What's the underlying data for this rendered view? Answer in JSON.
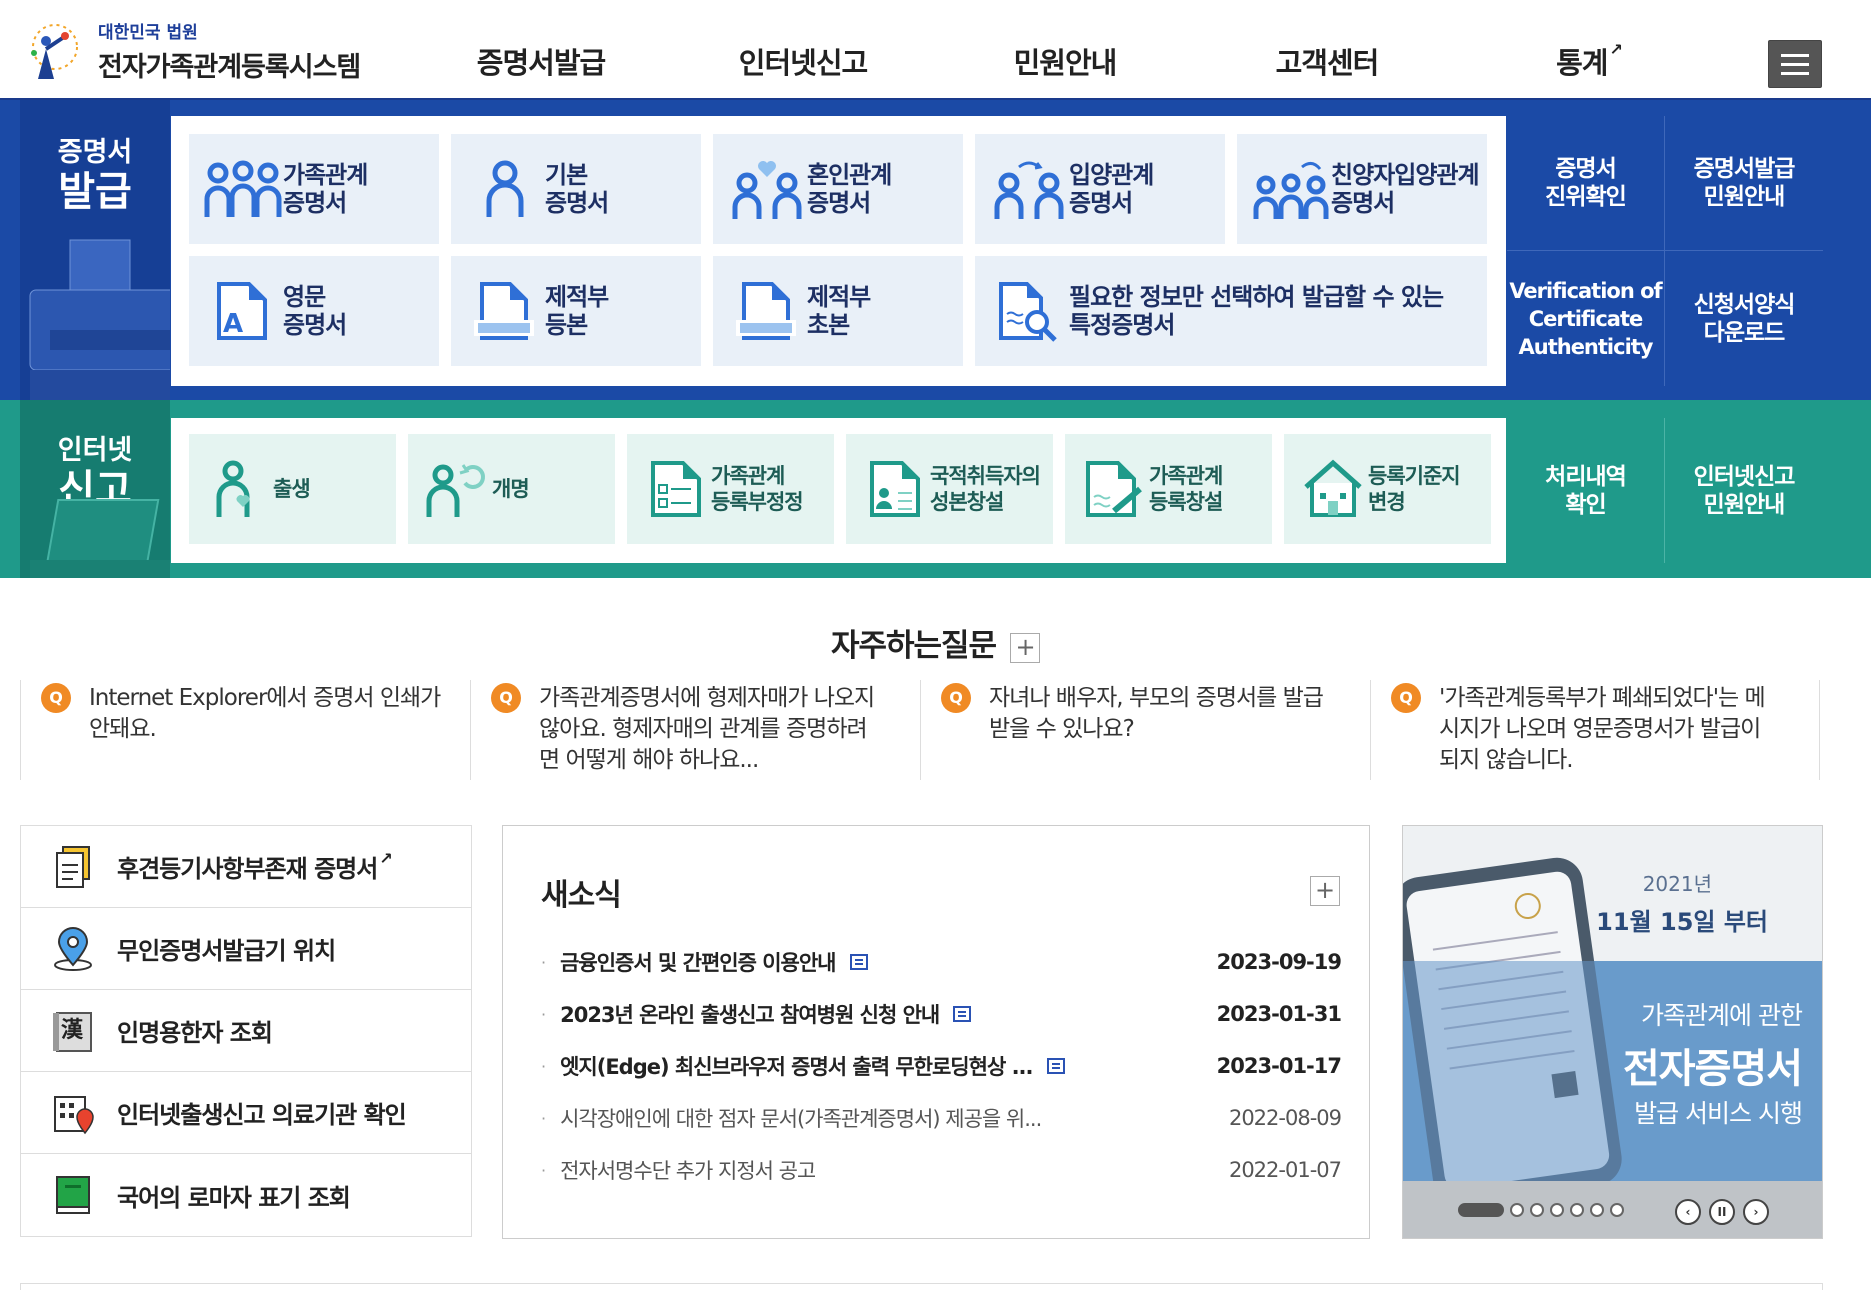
{
  "header": {
    "org": "대한민국 법원",
    "system": "전자가족관계등록시스템",
    "nav": [
      "증명서발급",
      "인터넷신고",
      "민원안내",
      "고객센터",
      "통계"
    ]
  },
  "cert": {
    "label1": "증명서",
    "label2": "발급",
    "tiles": [
      {
        "l1": "가족관계",
        "l2": "증명서",
        "icon": "family-icon"
      },
      {
        "l1": "기본",
        "l2": "증명서",
        "icon": "person-icon"
      },
      {
        "l1": "혼인관계",
        "l2": "증명서",
        "icon": "couple-heart-icon"
      },
      {
        "l1": "입양관계",
        "l2": "증명서",
        "icon": "adoption-icon"
      },
      {
        "l1": "친양자입양관계",
        "l2": "증명서",
        "icon": "full-adoption-icon"
      },
      {
        "l1": "영문",
        "l2": "증명서",
        "icon": "english-doc-icon"
      },
      {
        "l1": "제적부",
        "l2": "등본",
        "icon": "removed-register-doc-icon"
      },
      {
        "l1": "제적부",
        "l2": "초본",
        "icon": "removed-register-doc-icon"
      },
      {
        "l1": "필요한 정보만 선택하여 발급할 수 있는",
        "l2": "특정증명서",
        "icon": "doc-search-icon"
      }
    ],
    "side": [
      {
        "l1": "증명서",
        "l2": "진위확인"
      },
      {
        "l1": "증명서발급",
        "l2": "민원안내"
      },
      {
        "l1": "Verification of",
        "l2": "Certificate",
        "l3": "Authenticity"
      },
      {
        "l1": "신청서양식",
        "l2": "다운로드"
      }
    ]
  },
  "report": {
    "label1": "인터넷",
    "label2": "신고",
    "tiles": [
      {
        "l1": "출생",
        "l2": "",
        "icon": "birth-icon"
      },
      {
        "l1": "개명",
        "l2": "",
        "icon": "rename-icon"
      },
      {
        "l1": "가족관계",
        "l2": "등록부정정",
        "icon": "doc-check-icon"
      },
      {
        "l1": "국적취득자의",
        "l2": "성본창설",
        "icon": "id-doc-icon"
      },
      {
        "l1": "가족관계",
        "l2": "등록창설",
        "icon": "doc-pen-icon"
      },
      {
        "l1": "등록기준지",
        "l2": "변경",
        "icon": "house-icon"
      }
    ],
    "side": [
      {
        "l1": "처리내역",
        "l2": "확인"
      },
      {
        "l1": "인터넷신고",
        "l2": "민원안내"
      }
    ]
  },
  "faq": {
    "title": "자주하는질문",
    "badge": "Q",
    "items": [
      {
        "l1": "Internet Explorer에서 증명서 인쇄가",
        "l2": "안돼요.",
        "l3": ""
      },
      {
        "l1": "가족관계증명서에 형제자매가 나오지",
        "l2": "않아요. 형제자매의 관계를 증명하려",
        "l3": "면 어떻게 해야 하나요..."
      },
      {
        "l1": "자녀나 배우자, 부모의 증명서를 발급",
        "l2": "받을 수 있나요?",
        "l3": ""
      },
      {
        "l1": "'가족관계등록부가 폐쇄되었다'는 메",
        "l2": "시지가 나오며 영문증명서가 발급이",
        "l3": "되지 않습니다."
      }
    ]
  },
  "quick": [
    {
      "label": "후견등기사항부존재 증명서",
      "icon": "doc-icon"
    },
    {
      "label": "무인증명서발급기 위치",
      "icon": "location-pin-icon"
    },
    {
      "label": "인명용한자 조회",
      "icon": "hanja-book-icon"
    },
    {
      "label": "인터넷출생신고 의료기관 확인",
      "icon": "hospital-icon"
    },
    {
      "label": "국어의 로마자 표기 조회",
      "icon": "green-book-icon"
    }
  ],
  "news": {
    "title": "새소식",
    "items": [
      {
        "title": "금융인증서 및 간편인증 이용안내",
        "date": "2023-09-19",
        "new": true
      },
      {
        "title": "2023년 온라인 출생신고 참여병원 신청 안내",
        "date": "2023-01-31",
        "new": true
      },
      {
        "title": "엣지(Edge) 최신브라우저 증명서 출력 무한로딩현상 ...",
        "date": "2023-01-17",
        "new": true
      },
      {
        "title": "시각장애인에 대한 점자 문서(가족관계증명서) 제공을 위...",
        "date": "2022-08-09",
        "new": false
      },
      {
        "title": "전자서명수단 추가 지정서 공고",
        "date": "2022-01-07",
        "new": false
      }
    ]
  },
  "banner": {
    "year": "2021년",
    "date": "11월 15일 부터",
    "line1": "가족관계에 관한",
    "line2": "전자증명서",
    "line3": "발급 서비스 시행",
    "slides": 7
  }
}
